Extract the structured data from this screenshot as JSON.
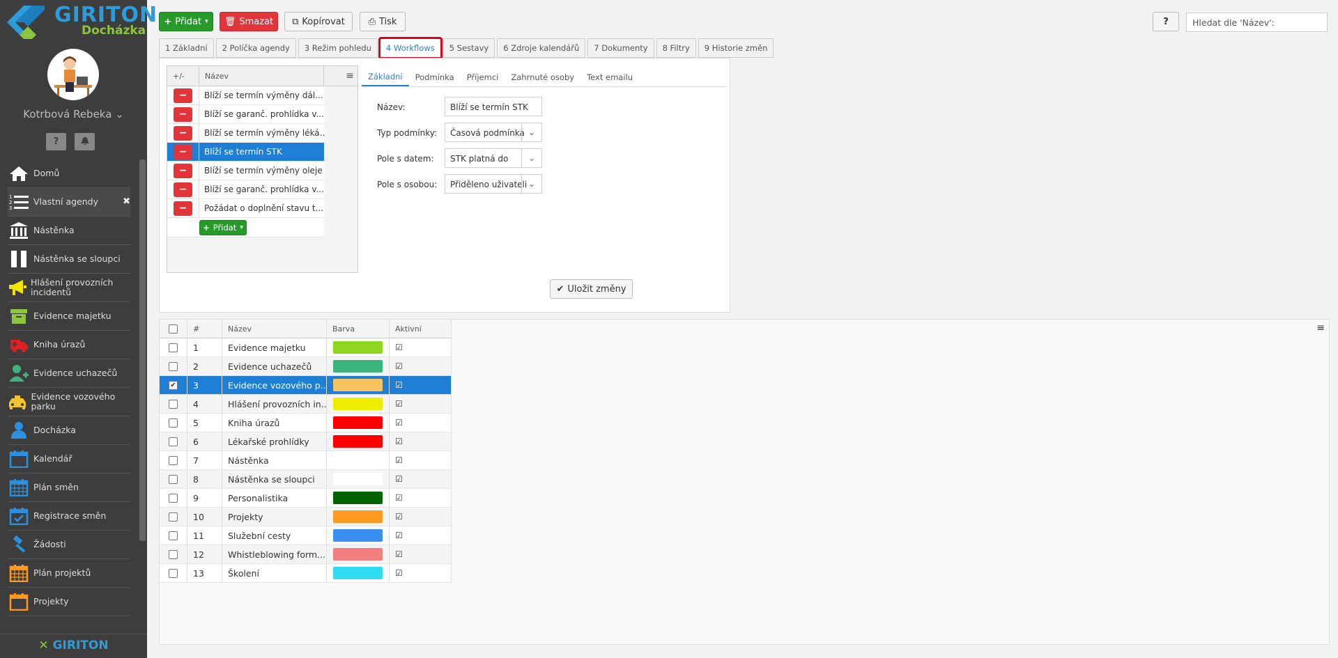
{
  "brand": {
    "name": "GIRITON",
    "sub": "Docházka",
    "footer": "GIRITON"
  },
  "user": {
    "name": "Kotrbová Rebeka ⌄"
  },
  "menu": [
    {
      "label": "Domů",
      "icon": "home-icon",
      "color": "#ffffff"
    },
    {
      "label": "Vlastní agendy",
      "icon": "numbered-list-icon",
      "color": "#ffffff",
      "active": true
    },
    {
      "label": "Nástěnka",
      "icon": "bank-icon",
      "color": "#ffffff"
    },
    {
      "label": "Nástěnka se sloupci",
      "icon": "columns-icon",
      "color": "#ffffff"
    },
    {
      "label": "Hlášení provozních incidentů",
      "icon": "megaphone-icon",
      "color": "#f5e600"
    },
    {
      "label": "Evidence majetku",
      "icon": "archive-icon",
      "color": "#8cc63f"
    },
    {
      "label": "Kniha úrazů",
      "icon": "ambulance-icon",
      "color": "#e02020"
    },
    {
      "label": "Evidence uchazečů",
      "icon": "user-plus-icon",
      "color": "#3fb27f"
    },
    {
      "label": "Evidence vozového parku",
      "icon": "taxi-icon",
      "color": "#f4c430"
    },
    {
      "label": "Docházka",
      "icon": "user-icon",
      "color": "#2d8fe0"
    },
    {
      "label": "Kalendář",
      "icon": "calendar-icon",
      "color": "#2d8fe0"
    },
    {
      "label": "Plán směn",
      "icon": "calendar-grid-icon",
      "color": "#2d8fe0"
    },
    {
      "label": "Registrace směn",
      "icon": "calendar-check-icon",
      "color": "#2d8fe0"
    },
    {
      "label": "Žádosti",
      "icon": "gavel-icon",
      "color": "#2d8fe0"
    },
    {
      "label": "Plán projektů",
      "icon": "calendar-grid-icon",
      "color": "#ff9a1f"
    },
    {
      "label": "Projekty",
      "icon": "calendar-icon",
      "color": "#ff9a1f"
    }
  ],
  "toolbar": {
    "add": "Přidat",
    "delete": "Smazat",
    "copy": "Kopírovat",
    "print": "Tisk",
    "help": "?",
    "search_placeholder": "Hledat dle 'Název':"
  },
  "tabs": [
    "1 Základní",
    "2 Políčka agendy",
    "3 Režim pohledu",
    "4 Workflows",
    "5 Sestavy",
    "6 Zdroje kalendářů",
    "7 Dokumenty",
    "8 Filtry",
    "9 Historie změn"
  ],
  "workflows": {
    "col1": "+/-",
    "col2": "Název",
    "add": "Přidat",
    "rows": [
      "Blíží se termín výměny dál...",
      "Blíží se garanč. prohlídka v...",
      "Blíží se termín výměny léká...",
      "Blíží se termín STK",
      "Blíží se termín výměny oleje",
      "Blíží se garanč. prohlídka v...",
      "Požádat o doplnění stavu t..."
    ],
    "selected": 3
  },
  "subtabs": [
    "Základní",
    "Podmínka",
    "Příjemci",
    "Zahrnuté osoby",
    "Text emailu"
  ],
  "form": {
    "name_label": "Název:",
    "name_value": "Blíží se termín STK",
    "type_label": "Typ podmínky:",
    "type_value": "Časová podmínka",
    "date_label": "Pole s datem:",
    "date_value": "STK platná do",
    "person_label": "Pole s osobou:",
    "person_value": "Přiděleno uživateli"
  },
  "save": "Uložit změny",
  "grid": {
    "headers": [
      "#",
      "Název",
      "Barva",
      "Aktivní"
    ],
    "rows": [
      {
        "n": "1",
        "name": "Evidence majetku",
        "color": "#8fd61f"
      },
      {
        "n": "2",
        "name": "Evidence uchazečů",
        "color": "#3cb57d"
      },
      {
        "n": "3",
        "name": "Evidence vozového p...",
        "color": "#f7c35f",
        "sel": true
      },
      {
        "n": "4",
        "name": "Hlášení provozních in...",
        "color": "#eded00"
      },
      {
        "n": "5",
        "name": "Kniha úrazů",
        "color": "#ff0000"
      },
      {
        "n": "6",
        "name": "Lékařské prohlídky",
        "color": "#ff0000"
      },
      {
        "n": "7",
        "name": "Nástěnka",
        "color": ""
      },
      {
        "n": "8",
        "name": "Nástěnka se sloupci",
        "color": "#ffffff"
      },
      {
        "n": "9",
        "name": "Personalistika",
        "color": "#006400"
      },
      {
        "n": "10",
        "name": "Projekty",
        "color": "#ff9a1f"
      },
      {
        "n": "11",
        "name": "Služební cesty",
        "color": "#3a8ff0"
      },
      {
        "n": "12",
        "name": "Whistleblowing form...",
        "color": "#f28080"
      },
      {
        "n": "13",
        "name": "Školení",
        "color": "#2fdcf0"
      }
    ]
  }
}
